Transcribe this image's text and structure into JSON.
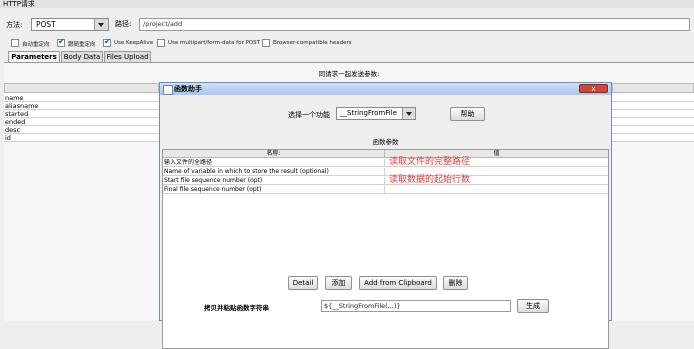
{
  "window": {
    "title": "HTTP请求"
  },
  "request": {
    "method_label": "方法:",
    "method_value": "POST",
    "path_label": "路径:",
    "path_value": "/project/add"
  },
  "options": [
    {
      "label": "自动重定向",
      "checked": false
    },
    {
      "label": "跟随重定向",
      "checked": true
    },
    {
      "label": "Use KeepAlive",
      "checked": true
    },
    {
      "label": "Use multipart/form-data for POST",
      "checked": false
    },
    {
      "label": "Browser-compatible headers",
      "checked": false
    }
  ],
  "tabs": [
    {
      "label": "Parameters",
      "active": true
    },
    {
      "label": "Body Data",
      "active": false
    },
    {
      "label": "Files Upload",
      "active": false
    }
  ],
  "params_header": "同请求一起发送参数:",
  "param_rows": [
    "name",
    "aliasname",
    "started",
    "ended",
    "desc",
    "id"
  ],
  "dialog": {
    "title": "函数助手",
    "close": "x",
    "choose_label": "选择一个功能",
    "function_value": "__StringFromFile",
    "help_button": "帮助",
    "params_title": "函数参数",
    "col_name": "名称:",
    "col_value": "值",
    "rows": [
      {
        "name": "输入文件的全路径",
        "value": "读取文件的完整路径"
      },
      {
        "name": "Name of variable in which to store the result (optional)",
        "value": ""
      },
      {
        "name": "Start file sequence number (opt)",
        "value": "读取数据的起始行数"
      },
      {
        "name": "Final file sequence number (opt)",
        "value": ""
      }
    ],
    "buttons": {
      "detail": "Detail",
      "add": "添加",
      "clipboard": "Add from Clipboard",
      "delete": "删除"
    },
    "copy_label": "拷贝并粘贴函数字符串",
    "copy_value": "${__StringFromFile(,,,)}",
    "generate_button": "生成"
  }
}
